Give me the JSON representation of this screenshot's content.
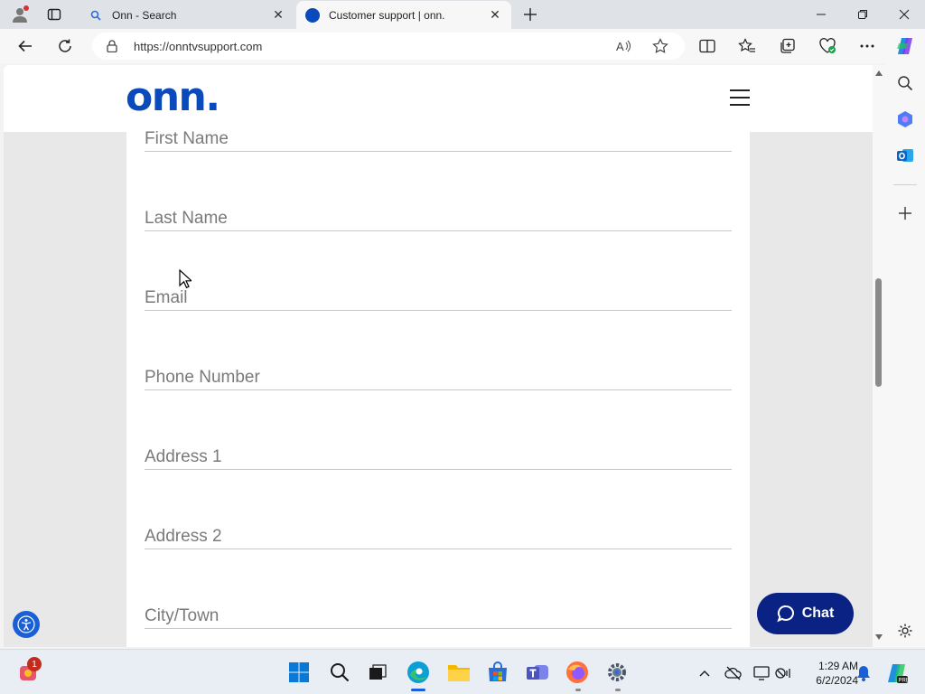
{
  "browser": {
    "tabs": [
      {
        "title": "Onn - Search",
        "active": false
      },
      {
        "title": "Customer support | onn.",
        "active": true
      }
    ],
    "url": "https://onntvsupport.com"
  },
  "site": {
    "logo": "onn.",
    "form_fields": [
      {
        "placeholder": "First Name"
      },
      {
        "placeholder": "Last Name"
      },
      {
        "placeholder": "Email"
      },
      {
        "placeholder": "Phone Number"
      },
      {
        "placeholder": "Address 1"
      },
      {
        "placeholder": "Address 2"
      },
      {
        "placeholder": "City/Town"
      }
    ],
    "chat_label": "Chat"
  },
  "taskbar": {
    "widgets_badge": "1",
    "time": "1:29 AM",
    "date": "6/2/2024"
  },
  "colors": {
    "brand_blue": "#0a4aba",
    "chat_navy": "#0b2285",
    "edge_accent": "#1a5fd6"
  }
}
